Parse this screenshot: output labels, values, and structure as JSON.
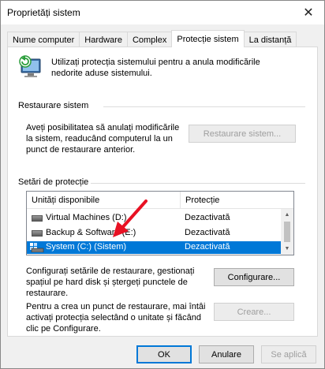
{
  "window": {
    "title": "Proprietăți sistem"
  },
  "tabs": [
    {
      "label": "Nume computer"
    },
    {
      "label": "Hardware"
    },
    {
      "label": "Complex"
    },
    {
      "label": "Protecție sistem"
    },
    {
      "label": "La distanță"
    }
  ],
  "active_tab": "Protecție sistem",
  "info": {
    "text": "Utilizați protecția sistemului pentru a anula modificările nedorite aduse sistemului."
  },
  "restore": {
    "group_label": "Restaurare sistem",
    "description": "Aveți posibilitatea să anulați modificările la sistem, readucând computerul la un punct de restaurare anterior.",
    "button_label": "Restaurare sistem..."
  },
  "protection": {
    "group_label": "Setări de protecție",
    "columns": [
      "Unități disponibile",
      "Protecție"
    ],
    "rows": [
      {
        "drive": "Virtual Machines (D:)",
        "status": "Dezactivată",
        "icon": "hard-drive-icon",
        "selected": false
      },
      {
        "drive": "Backup & Software (E:)",
        "status": "Dezactivată",
        "icon": "hard-drive-icon",
        "selected": false
      },
      {
        "drive": "System (C:) (Sistem)",
        "status": "Dezactivată",
        "icon": "system-drive-icon",
        "selected": true
      }
    ],
    "configure_text": "Configurați setările de restaurare, gestionați spațiul pe hard disk și ștergeți punctele de restaurare.",
    "configure_button": "Configurare...",
    "create_text": "Pentru a crea un punct de restaurare, mai întâi activați protecția selectând o unitate și făcând clic pe Configurare.",
    "create_button": "Creare..."
  },
  "footer": {
    "ok": "OK",
    "cancel": "Anulare",
    "apply": "Se aplică"
  },
  "colors": {
    "selection": "#0078d7",
    "arrow": "#e81123",
    "accent": "#0078d7"
  }
}
